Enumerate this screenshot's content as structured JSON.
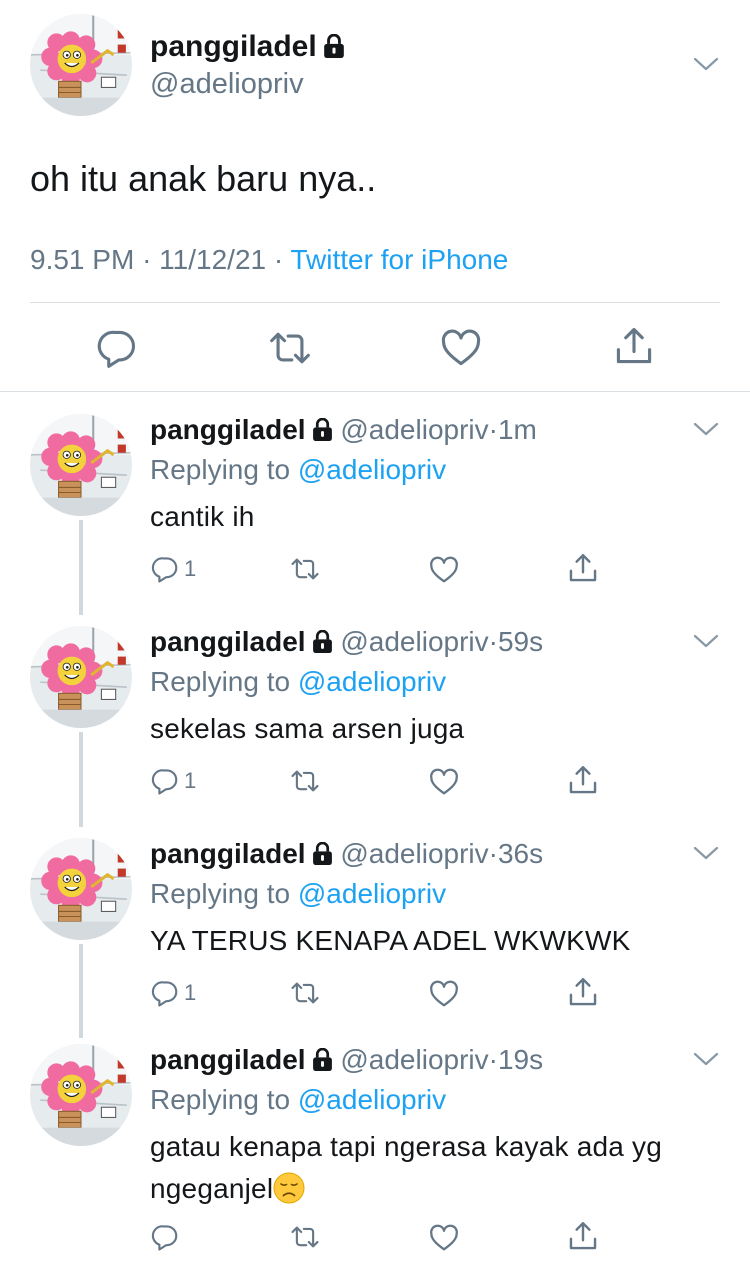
{
  "main_tweet": {
    "display_name": "panggiladel",
    "handle": "@adeliopriv",
    "text": "oh itu anak baru nya..",
    "time": "9.51 PM",
    "date": "11/12/21",
    "separator": "·",
    "source": "Twitter for iPhone",
    "icons": [
      "avatar",
      "lock-icon",
      "chevron-down-icon",
      "reply-icon",
      "retweet-icon",
      "like-icon",
      "share-icon"
    ]
  },
  "replies": [
    {
      "display_name": "panggiladel",
      "handle": "@adeliopriv",
      "dot": "·",
      "time": "1m",
      "replying_prefix": "Replying to",
      "replying_to": "@adeliopriv",
      "text": "cantik ih",
      "reply_count": "1"
    },
    {
      "display_name": "panggiladel",
      "handle": "@adeliopriv",
      "dot": "·",
      "time": "59s",
      "replying_prefix": "Replying to",
      "replying_to": "@adeliopriv",
      "text": "sekelas sama arsen juga",
      "reply_count": "1"
    },
    {
      "display_name": "panggiladel",
      "handle": "@adeliopriv",
      "dot": "·",
      "time": "36s",
      "replying_prefix": "Replying to",
      "replying_to": "@adeliopriv",
      "text": "YA TERUS KENAPA ADEL WKWKWK",
      "reply_count": "1"
    },
    {
      "display_name": "panggiladel",
      "handle": "@adeliopriv",
      "dot": "·",
      "time": "19s",
      "replying_prefix": "Replying to",
      "replying_to": "@adeliopriv",
      "text": "gatau kenapa tapi ngerasa kayak ada yg ngeganjel",
      "emoji": "disappointed-face-emoji",
      "reply_count": ""
    }
  ],
  "colors": {
    "link": "#1da1f2",
    "secondary": "#657786",
    "text": "#14171a",
    "divider": "#dadfe3"
  }
}
